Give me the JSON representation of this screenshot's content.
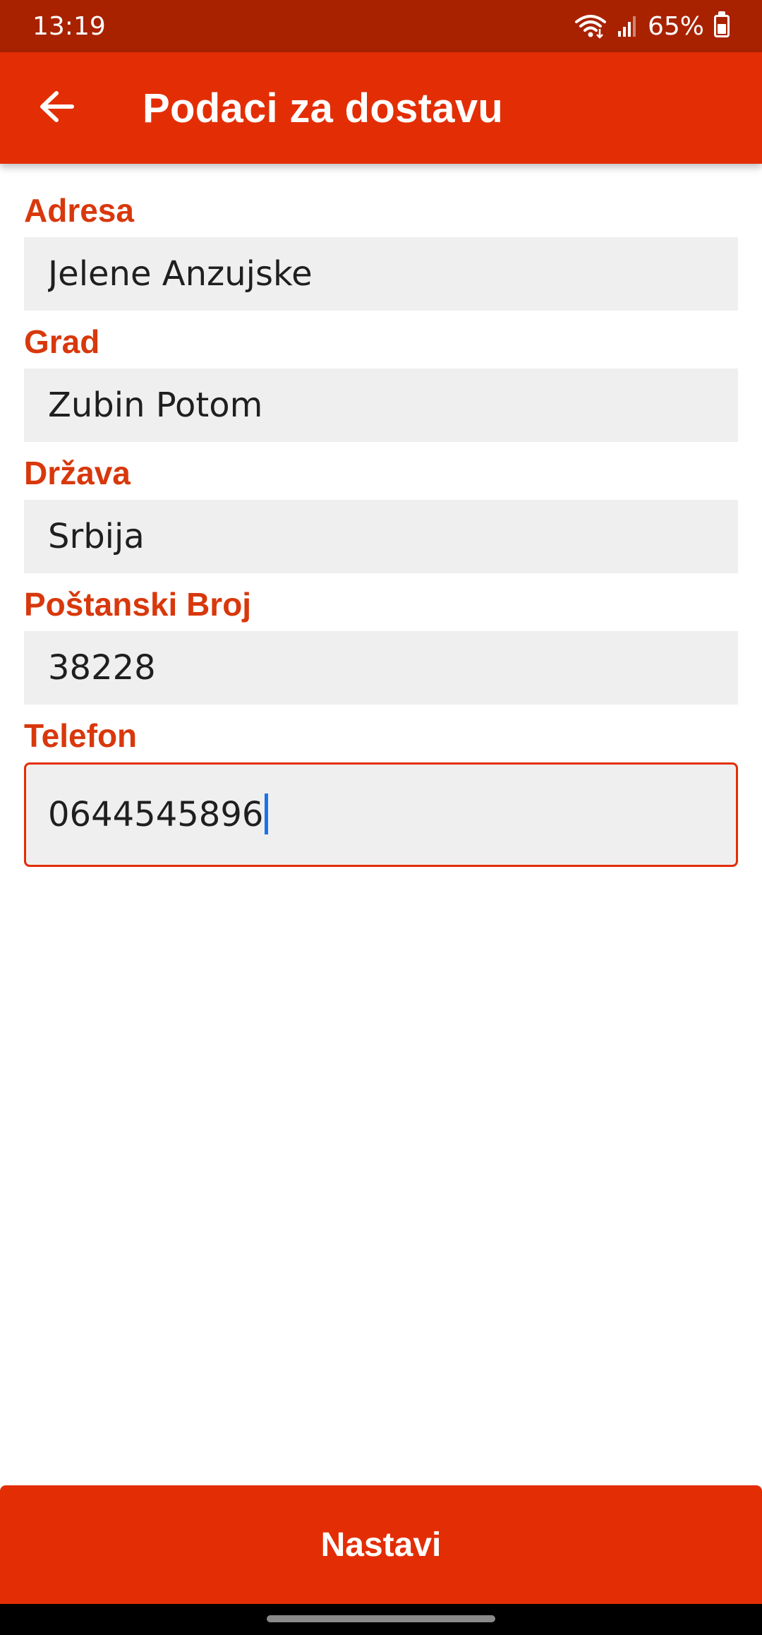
{
  "status_bar": {
    "time": "13:19",
    "battery_text": "65%",
    "battery_level": 0.65,
    "icons": [
      "wifi-icon",
      "signal-icon",
      "battery-icon"
    ]
  },
  "app_bar": {
    "title": "Podaci za dostavu",
    "back_icon": "arrow-left-icon"
  },
  "form": {
    "fields": [
      {
        "label": "Adresa",
        "value": "Jelene Anzujske"
      },
      {
        "label": "Grad",
        "value": "Zubin Potom"
      },
      {
        "label": "Država",
        "value": "Srbija"
      },
      {
        "label": "Poštanski Broj",
        "value": "38228"
      },
      {
        "label": "Telefon",
        "value": "0644545896"
      }
    ]
  },
  "footer": {
    "continue_label": "Nastavi"
  },
  "colors": {
    "status_bar": "#a82200",
    "primary": "#e32e05",
    "label": "#d8380c",
    "input_bg": "#efefef",
    "caret": "#1a73e8"
  }
}
